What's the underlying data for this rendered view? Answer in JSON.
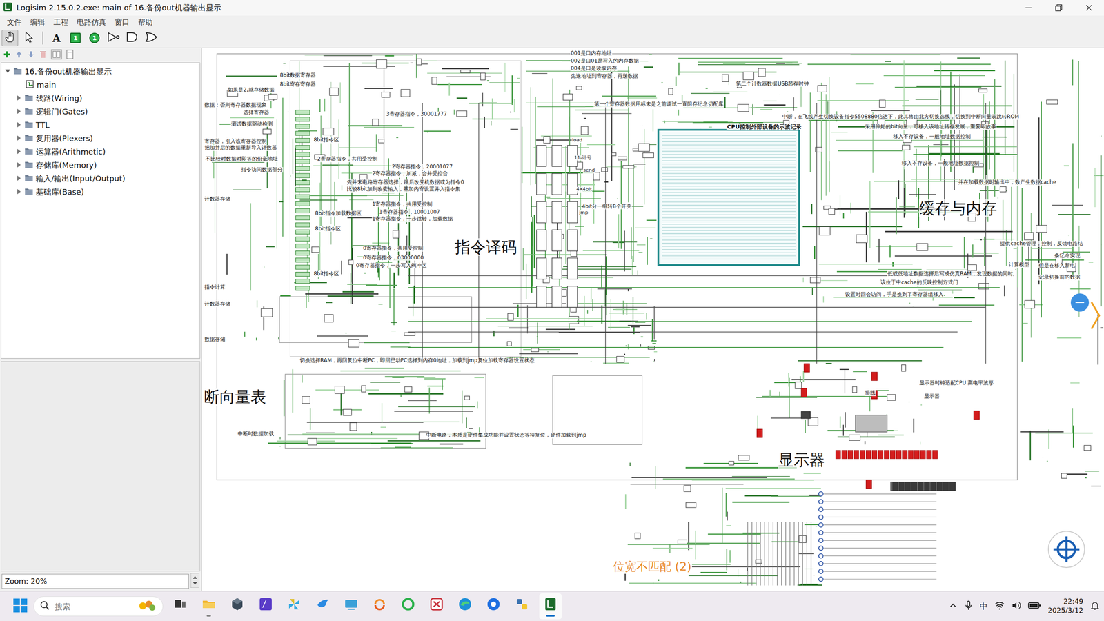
{
  "window": {
    "title": "Logisim 2.15.0.2.exe: main of 16.备份out机器输出显示"
  },
  "menu": [
    "文件",
    "编辑",
    "工程",
    "电路仿真",
    "窗口",
    "帮助"
  ],
  "toolbar": [
    {
      "kind": "poke",
      "selected": true
    },
    {
      "kind": "select",
      "selected": false
    },
    {
      "kind": "text",
      "label": "A",
      "selected": false
    },
    {
      "kind": "input",
      "label": "1",
      "selected": false
    },
    {
      "kind": "output",
      "label": "1",
      "selected": false
    },
    {
      "kind": "not",
      "selected": false
    },
    {
      "kind": "and",
      "selected": false
    },
    {
      "kind": "or",
      "selected": false
    }
  ],
  "tree": {
    "root": {
      "label": "16.备份out机器输出显示",
      "expanded": true
    },
    "circuits": [
      {
        "label": "main",
        "selected": false
      }
    ],
    "libraries": [
      {
        "label": "线路(Wiring)",
        "expanded": false
      },
      {
        "label": "逻辑门(Gates)",
        "expanded": false
      },
      {
        "label": "TTL",
        "expanded": false
      },
      {
        "label": "复用器(Plexers)",
        "expanded": false
      },
      {
        "label": "运算器(Arithmetic)",
        "expanded": false
      },
      {
        "label": "存储库(Memory)",
        "expanded": false
      },
      {
        "label": "输入/输出(Input/Output)",
        "expanded": false
      },
      {
        "label": "基础库(Base)",
        "expanded": false
      }
    ]
  },
  "zoom": "Zoom: 20%",
  "canvas": {
    "labels": [
      {
        "text": "001是口内存地址",
        "kind": "small"
      },
      {
        "text": "002是口01是写入的内存数据",
        "kind": "small"
      },
      {
        "text": "004是口是读取内存",
        "kind": "small"
      },
      {
        "text": "先送地址到寄存器，再送数据",
        "kind": "small"
      },
      {
        "text": "8bit数据寄存器",
        "kind": "small"
      },
      {
        "text": "8bit寄存寄存器",
        "kind": "small"
      },
      {
        "text": "如果是2,就存储数据",
        "kind": "small"
      },
      {
        "text": "第二个计数器数据USB芯存时钟",
        "kind": "small"
      },
      {
        "text": "第一个寄存器数据用标来是之前调试一直阻存纪念切配库",
        "kind": "small"
      },
      {
        "text": "数据：否则寄存器数据现象",
        "kind": "small"
      },
      {
        "text": "选择寄存器",
        "kind": "small"
      },
      {
        "text": "3寄存器指令，30001777",
        "kind": "small"
      },
      {
        "text": "中断，在飞线产生切换设备指令5508880信达下，此其将由北方切换选线，切换到中断向量表跳转ROM",
        "kind": "small"
      },
      {
        "text": "测试数据驱动检测",
        "kind": "small"
      },
      {
        "text": "CPU控制外部设备的示波记录",
        "kind": "title"
      },
      {
        "text": "采用原始的bit向量，可移入该地址转存发展，重复即故事",
        "kind": "small"
      },
      {
        "text": "移入不存设备，一般地址数据控制",
        "kind": "small"
      },
      {
        "text": "8bit指令区",
        "kind": "small"
      },
      {
        "text": "寄存器，引入该寄存器控制",
        "kind": "small"
      },
      {
        "text": "把加并后的数据重新导入计数器",
        "kind": "small"
      },
      {
        "text": "不比较时数据时即等的份毫地址",
        "kind": "small"
      },
      {
        "text": "2寄存器指令，共用受控制",
        "kind": "small"
      },
      {
        "text": "指令访问数据部分",
        "kind": "small"
      },
      {
        "text": "2寄存器指令，20001077",
        "kind": "small"
      },
      {
        "text": "2寄存器指令，加减，合并受控合",
        "kind": "small"
      },
      {
        "text": "先并来电路寄存器选择，跳后改变机数据或为指令0",
        "kind": "small"
      },
      {
        "text": "比较8bit加到改变输入，基加内寄设置并入指令集",
        "kind": "small"
      },
      {
        "text": "移入不存设备，一般地址数据控制",
        "kind": "small"
      },
      {
        "text": "并在加载数据时输出中，数产生数据cache",
        "kind": "small"
      },
      {
        "text": "计数器存储",
        "kind": "small"
      },
      {
        "text": "1寄存器指令，共用受控制",
        "kind": "small"
      },
      {
        "text": "1寄存器指令，10001007",
        "kind": "small"
      },
      {
        "text": "1寄存器指令，一步跳转，加载数据",
        "kind": "small"
      },
      {
        "text": "缓存与内存",
        "kind": "big"
      },
      {
        "text": "8bit指令加载数据区",
        "kind": "small"
      },
      {
        "text": "8bit指令区",
        "kind": "small"
      },
      {
        "text": "4bit分一组转8个开关",
        "kind": "small"
      },
      {
        "text": "指令译码",
        "kind": "big"
      },
      {
        "text": "0寄存器指令，共用受控制",
        "kind": "small"
      },
      {
        "text": "0寄存器指令，03000000",
        "kind": "small"
      },
      {
        "text": "0寄存器指令，一步写入阀冲区",
        "kind": "small"
      },
      {
        "text": "8bit指令区",
        "kind": "small"
      },
      {
        "text": "指令计算",
        "kind": "small"
      },
      {
        "text": "计数器存储",
        "kind": "small"
      },
      {
        "text": "数据存储",
        "kind": "small"
      },
      {
        "text": "提供cache管理，控制，反馈电路结",
        "kind": "small"
      },
      {
        "text": "条忆命实现",
        "kind": "small"
      },
      {
        "text": "但是在移入新电",
        "kind": "small"
      },
      {
        "text": "计算模型",
        "kind": "small"
      },
      {
        "text": "记录切换前的数据",
        "kind": "small"
      },
      {
        "text": "低或低地址数据选择后写成仿真RAM，发现数据的同时",
        "kind": "small"
      },
      {
        "text": "该位于中cache的反映控制方式门",
        "kind": "small"
      },
      {
        "text": "设置时回会访问，手是换到了寄存器组移入",
        "kind": "small"
      },
      {
        "text": "切换选择RAM，再回复位中断PC，即回已动PC选择到内存0地址，加载到jmp复位加载寄存器设置状态",
        "kind": "small"
      },
      {
        "text": "断向量表",
        "kind": "big"
      },
      {
        "text": "中断时数据加载",
        "kind": "small"
      },
      {
        "text": "中断电路，本质是硬件集成功能并设置状态等待复位，硬件加载到jmp",
        "kind": "small"
      },
      {
        "text": "显示器时钟适配CPU 高电平波形",
        "kind": "small"
      },
      {
        "text": "排线",
        "kind": "small"
      },
      {
        "text": "显示器",
        "kind": "small"
      },
      {
        "text": "显示器",
        "kind": "big"
      },
      {
        "text": "位宽不匹配 (2)",
        "kind": "warning"
      },
      {
        "text": "load",
        "kind": "component"
      },
      {
        "text": "11-计号",
        "kind": "component"
      },
      {
        "text": "send",
        "kind": "component"
      },
      {
        "text": "4X4bit",
        "kind": "component"
      },
      {
        "text": "jmp",
        "kind": "component"
      }
    ]
  },
  "taskbar": {
    "search": {
      "placeholder": "搜索"
    },
    "apps": [
      {
        "kind": "taskview",
        "open": false,
        "active": false
      },
      {
        "kind": "explorer",
        "open": true,
        "active": false
      },
      {
        "kind": "cube",
        "open": false,
        "active": false
      },
      {
        "kind": "vs",
        "open": false,
        "active": false
      },
      {
        "kind": "pinwheel",
        "open": false,
        "active": false
      },
      {
        "kind": "bird",
        "open": false,
        "active": false
      },
      {
        "kind": "remote",
        "open": false,
        "active": false
      },
      {
        "kind": "swirl",
        "open": false,
        "active": false
      },
      {
        "kind": "ring",
        "open": false,
        "active": false
      },
      {
        "kind": "redapp",
        "open": false,
        "active": false
      },
      {
        "kind": "edge",
        "open": false,
        "active": false
      },
      {
        "kind": "bluedot",
        "open": false,
        "active": false
      },
      {
        "kind": "python",
        "open": false,
        "active": false
      },
      {
        "kind": "logisim",
        "open": true,
        "active": true
      }
    ],
    "ime": "中",
    "time": "22:49",
    "date": "2025/3/12"
  }
}
